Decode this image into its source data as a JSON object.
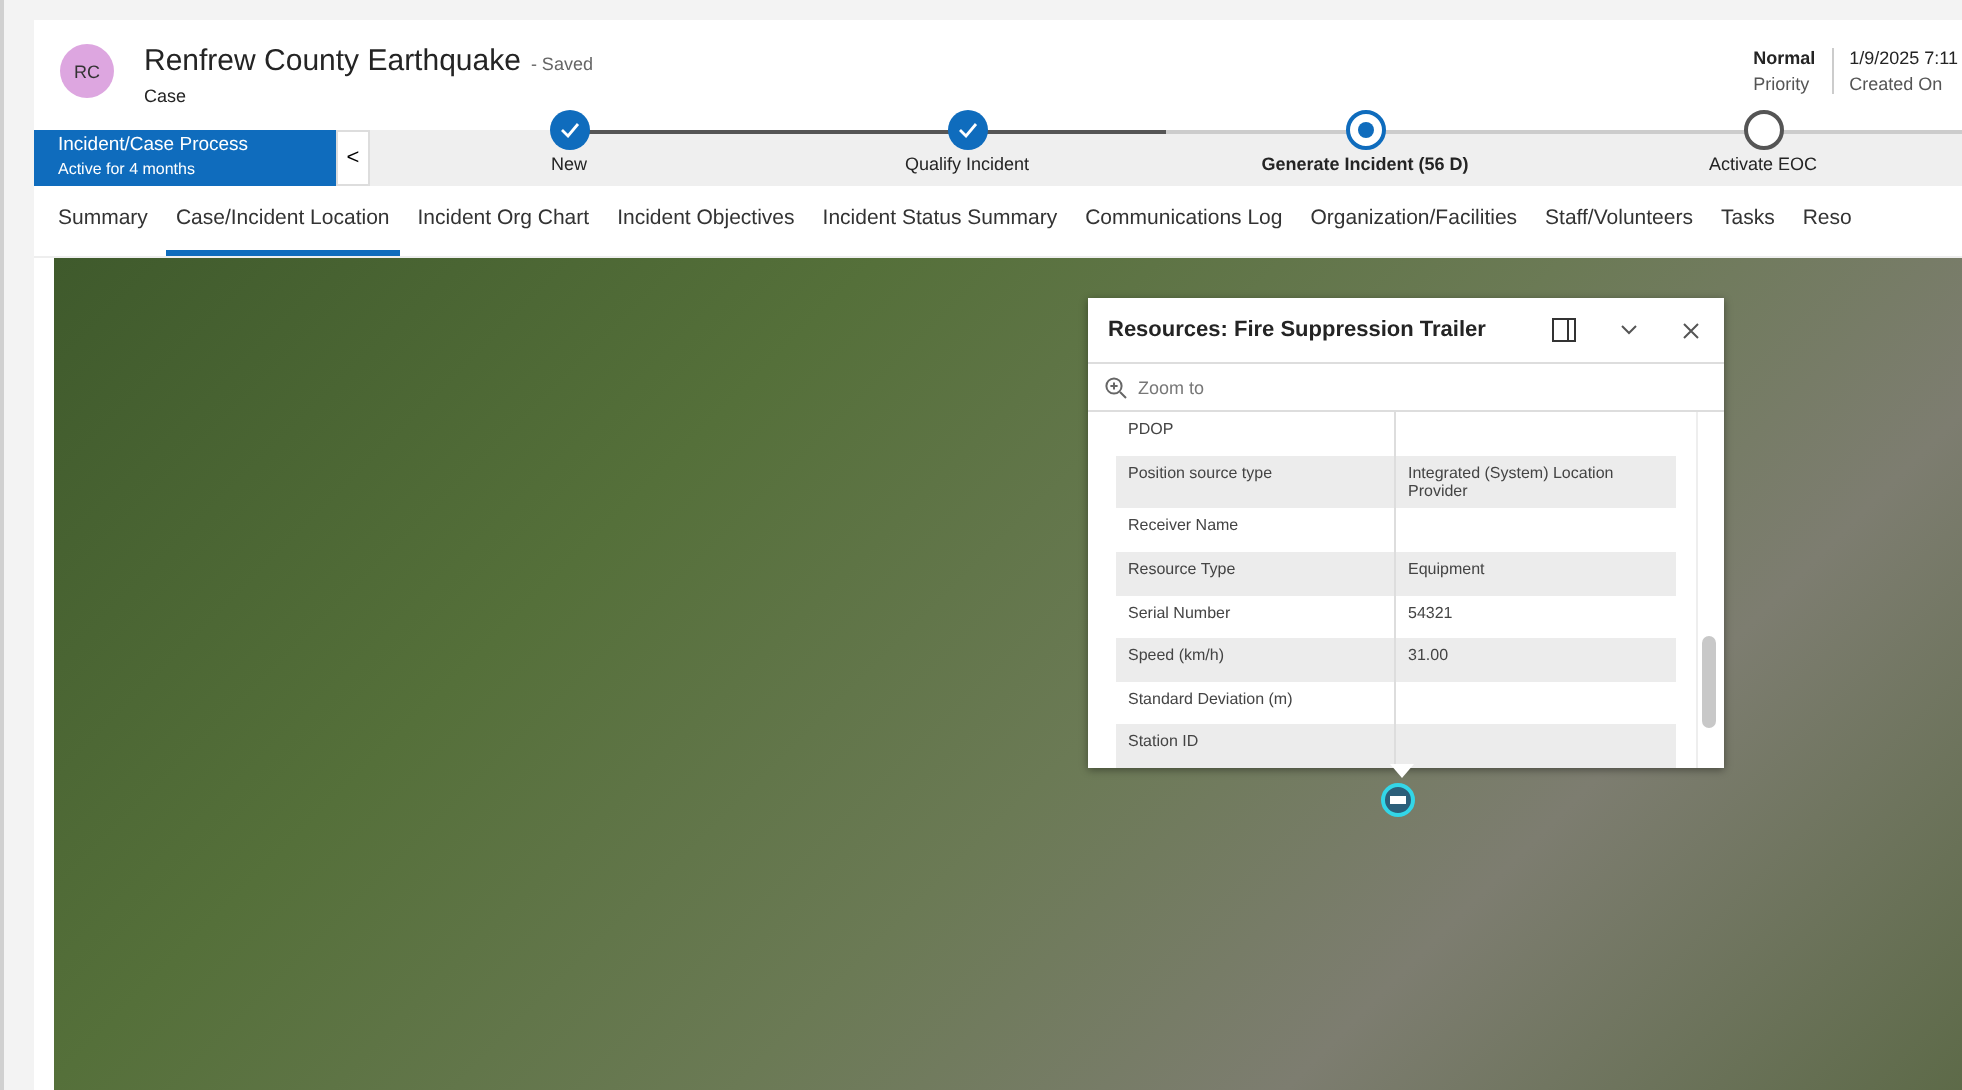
{
  "record": {
    "initials": "RC",
    "title": "Renfrew County Earthquake",
    "save_state": "- Saved",
    "entity": "Case"
  },
  "header_fields": [
    {
      "value": "Normal",
      "label": "Priority"
    },
    {
      "value": "1/9/2025 7:11",
      "label": "Created On"
    }
  ],
  "process": {
    "name": "Incident/Case Process",
    "duration": "Active for 4 months",
    "collapse_glyph": "<",
    "stages": [
      {
        "label": "New",
        "completed": true,
        "active": false
      },
      {
        "label": "Qualify Incident",
        "completed": true,
        "active": false
      },
      {
        "label": "Generate Incident  (56 D)",
        "completed": false,
        "active": true
      },
      {
        "label": "Activate EOC",
        "completed": false,
        "active": false
      }
    ]
  },
  "tabs": [
    {
      "label": "Summary",
      "selected": false
    },
    {
      "label": "Case/Incident Location",
      "selected": true
    },
    {
      "label": "Incident Org Chart",
      "selected": false
    },
    {
      "label": "Incident Objectives",
      "selected": false
    },
    {
      "label": "Incident Status Summary",
      "selected": false
    },
    {
      "label": "Communications Log",
      "selected": false
    },
    {
      "label": "Organization/Facilities",
      "selected": false
    },
    {
      "label": "Staff/Volunteers",
      "selected": false
    },
    {
      "label": "Tasks",
      "selected": false
    },
    {
      "label": "Reso",
      "selected": false
    }
  ],
  "popup": {
    "title": "Resources: Fire Suppression Trailer",
    "zoom_action": "Zoom to",
    "rows": [
      {
        "field": "PDOP",
        "value": ""
      },
      {
        "field": "Position source type",
        "value": "Integrated (System) Location Provider"
      },
      {
        "field": "Receiver Name",
        "value": ""
      },
      {
        "field": "Resource Type",
        "value": "Equipment"
      },
      {
        "field": "Serial Number",
        "value": "54321"
      },
      {
        "field": "Speed (km/h)",
        "value": "31.00"
      },
      {
        "field": "Standard Deviation (m)",
        "value": ""
      },
      {
        "field": "Station ID",
        "value": ""
      }
    ]
  }
}
